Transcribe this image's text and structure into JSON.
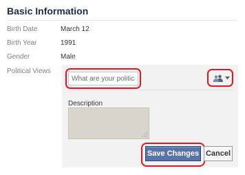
{
  "section": {
    "title": "Basic Information"
  },
  "fields": [
    {
      "label": "Birth Date",
      "value": "March 12"
    },
    {
      "label": "Birth Year",
      "value": "1991"
    },
    {
      "label": "Gender",
      "value": "Male"
    },
    {
      "label": "Political Views",
      "value": ""
    }
  ],
  "editor": {
    "political_input_placeholder": "What are your political views?",
    "political_input_value": "",
    "privacy_icon": "friends-audience-icon",
    "description_label": "Description",
    "description_value": "",
    "save_label": "Save Changes",
    "cancel_label": "Cancel"
  },
  "colors": {
    "title": "#1c2a47",
    "highlight": "#e4151f",
    "save_button": "#5b74a8",
    "panel_background": "#f2f2f2",
    "textarea_background": "#d9d5cd"
  }
}
